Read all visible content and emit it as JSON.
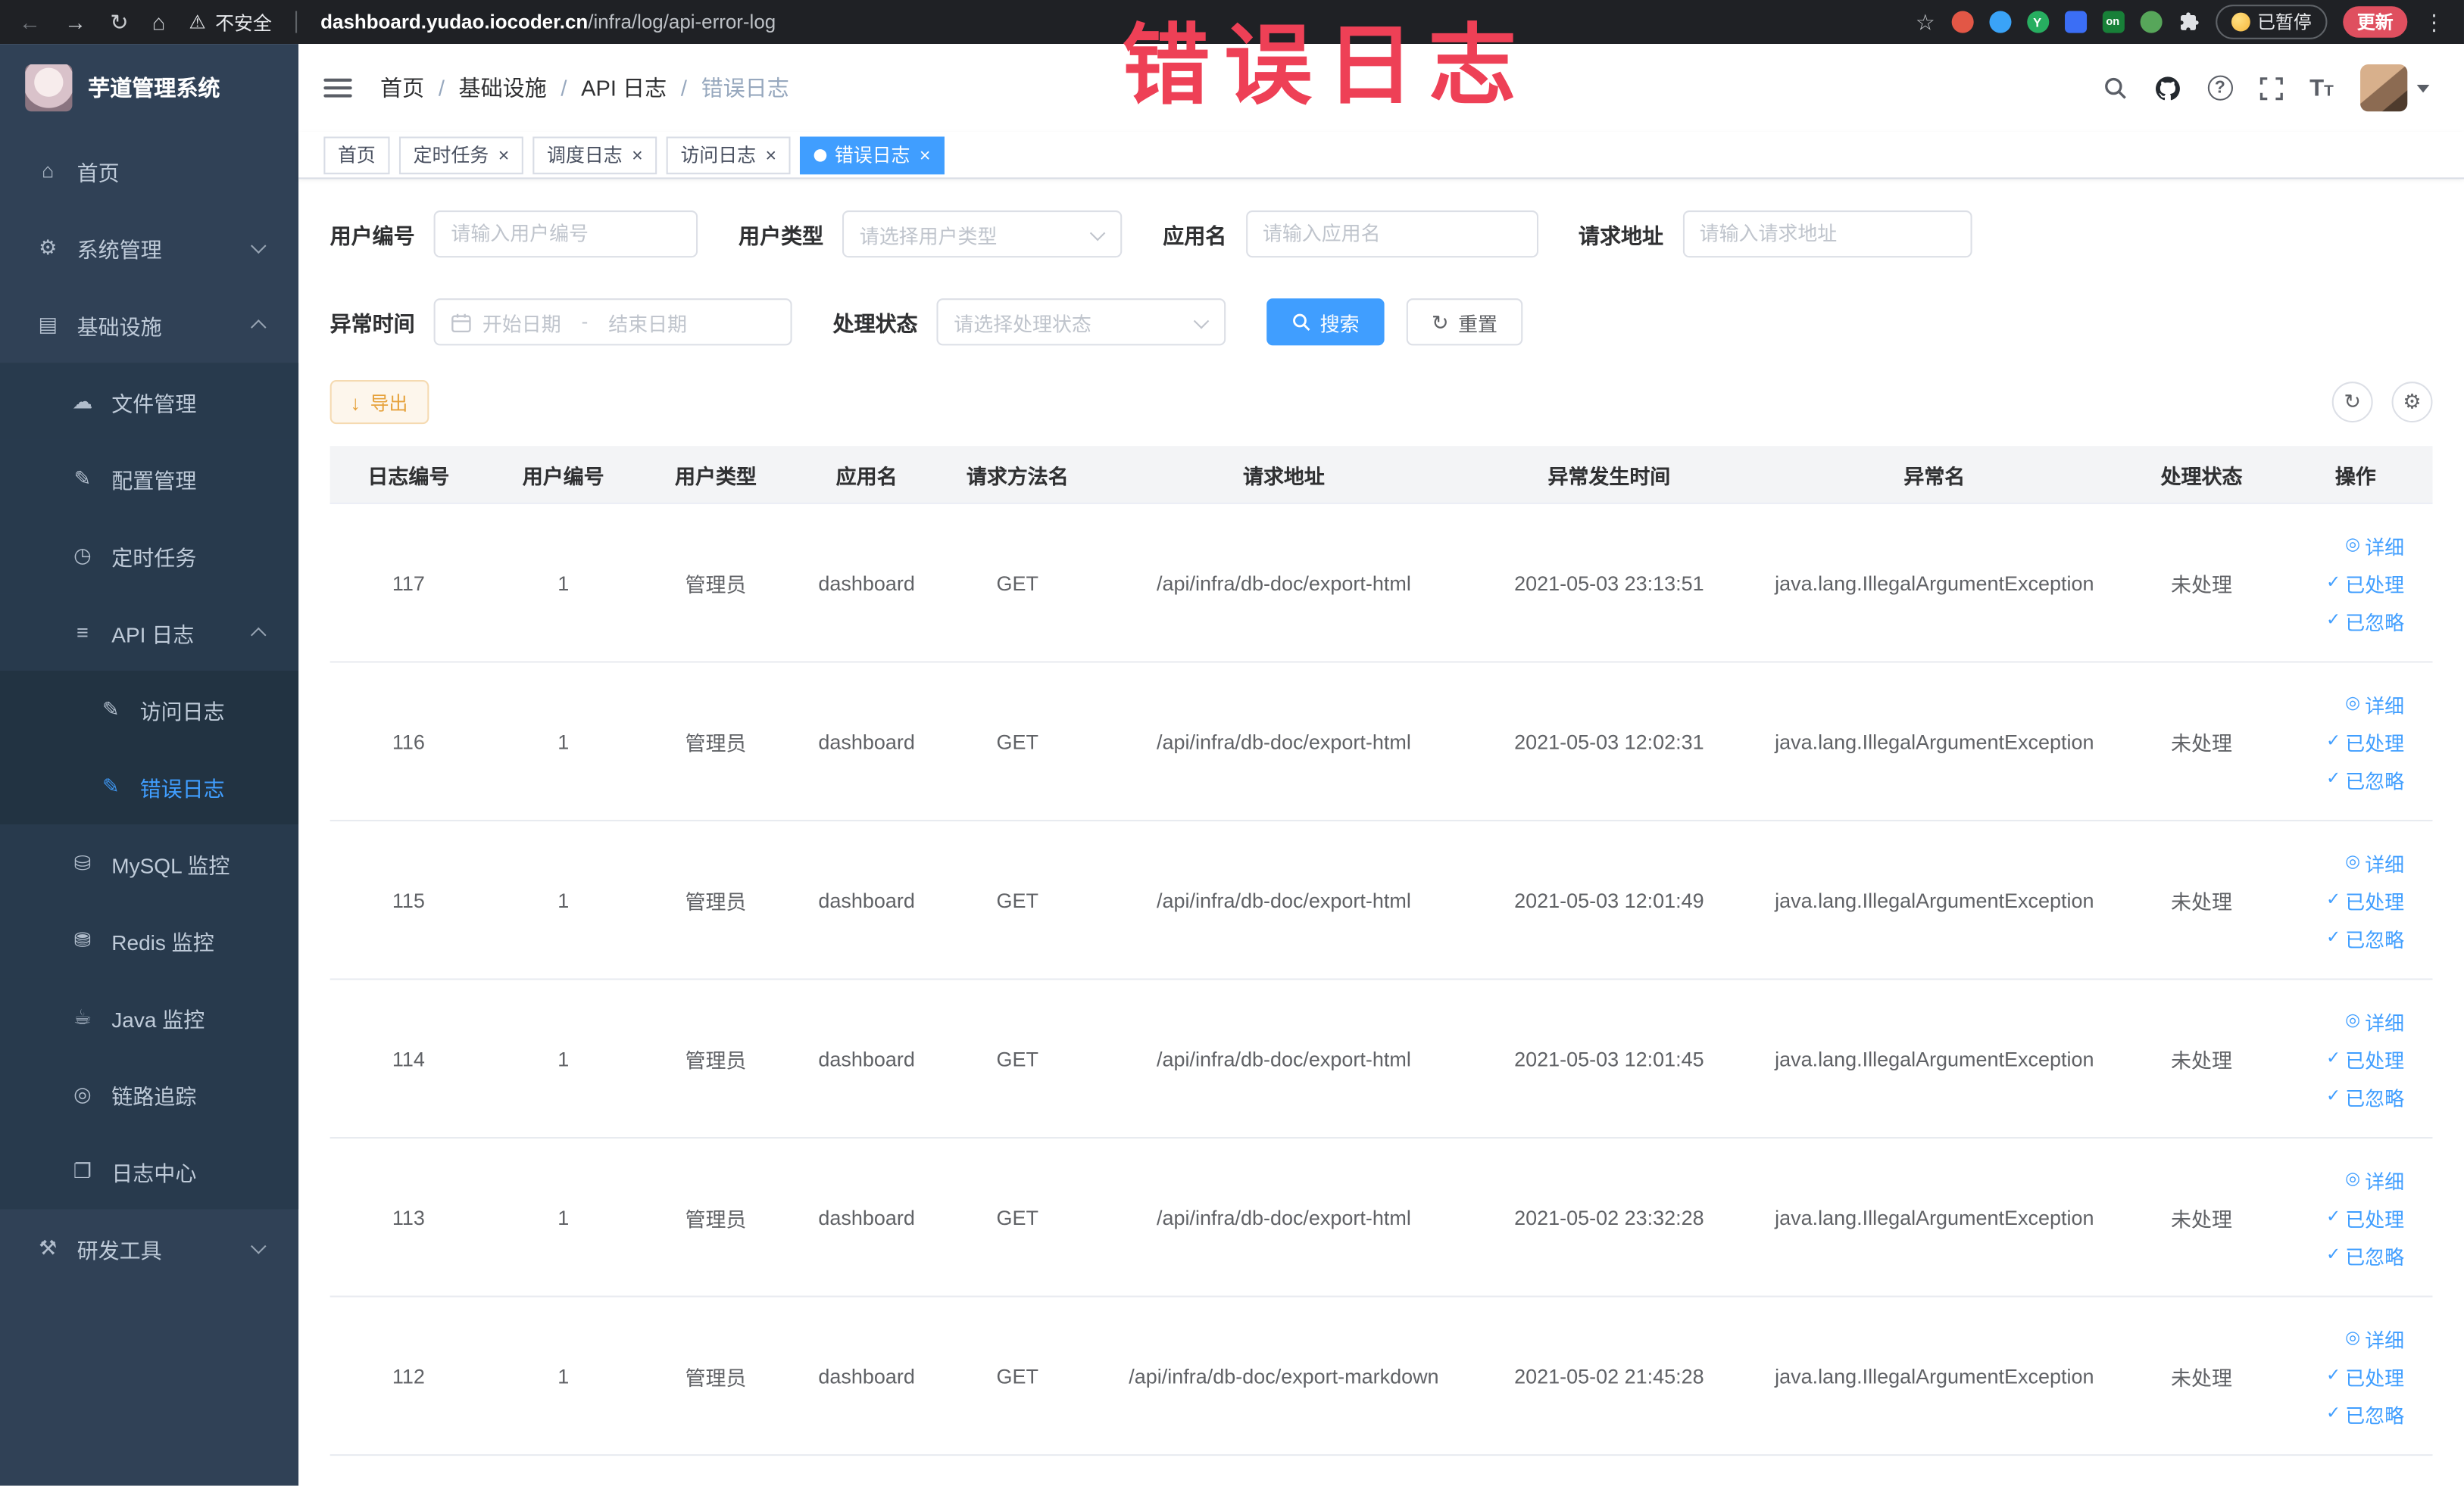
{
  "browser": {
    "security_label": "不安全",
    "url_domain": "dashboard.yudao.iocoder.cn",
    "url_path": "/infra/log/api-error-log",
    "paused_badge_label": "已暂停",
    "update_button_label": "更新",
    "extension_on_label": "on",
    "extension_y_label": "Y"
  },
  "annotation": {
    "watermark_text": "错误日志"
  },
  "sidebar": {
    "logo_title": "芋道管理系统",
    "menu": [
      {
        "name": "home",
        "label": "首页",
        "icon": "home-icon",
        "level": 1
      },
      {
        "name": "system-mgmt",
        "label": "系统管理",
        "icon": "gear-icon",
        "level": 1,
        "arrow": "down"
      },
      {
        "name": "infrastructure",
        "label": "基础设施",
        "icon": "infra-icon",
        "level": 1,
        "arrow": "up"
      },
      {
        "name": "file-mgmt",
        "label": "文件管理",
        "icon": "cloud-icon",
        "level": 2
      },
      {
        "name": "config-mgmt",
        "label": "配置管理",
        "icon": "edit-icon",
        "level": 2
      },
      {
        "name": "scheduled-tasks",
        "label": "定时任务",
        "icon": "clock-icon",
        "level": 2
      },
      {
        "name": "api-log",
        "label": "API 日志",
        "icon": "log-icon",
        "level": 2,
        "arrow": "up"
      },
      {
        "name": "access-log",
        "label": "访问日志",
        "icon": "edit-square-icon",
        "level": 3
      },
      {
        "name": "error-log",
        "label": "错误日志",
        "icon": "edit-square-icon",
        "level": 3,
        "active": true
      },
      {
        "name": "mysql-monitor",
        "label": "MySQL 监控",
        "icon": "database-icon",
        "level": 2
      },
      {
        "name": "redis-monitor",
        "label": "Redis 监控",
        "icon": "stack-icon",
        "level": 2
      },
      {
        "name": "java-monitor",
        "label": "Java 监控",
        "icon": "coffee-icon",
        "level": 2
      },
      {
        "name": "trace",
        "label": "链路追踪",
        "icon": "eye-icon",
        "level": 2
      },
      {
        "name": "log-center",
        "label": "日志中心",
        "icon": "document-icon",
        "level": 2
      },
      {
        "name": "dev-tools",
        "label": "研发工具",
        "icon": "tools-icon",
        "level": 1,
        "arrow": "down"
      }
    ]
  },
  "breadcrumb": [
    "首页",
    "基础设施",
    "API 日志",
    "错误日志"
  ],
  "tabs": [
    {
      "name": "home",
      "label": "首页",
      "closable": false,
      "active": false
    },
    {
      "name": "scheduled-task",
      "label": "定时任务",
      "closable": true,
      "active": false
    },
    {
      "name": "schedule-log",
      "label": "调度日志",
      "closable": true,
      "active": false
    },
    {
      "name": "access-log",
      "label": "访问日志",
      "closable": true,
      "active": false
    },
    {
      "name": "error-log",
      "label": "错误日志",
      "closable": true,
      "active": true
    }
  ],
  "filters": {
    "user_id": {
      "label": "用户编号",
      "placeholder": "请输入用户编号"
    },
    "user_type": {
      "label": "用户类型",
      "placeholder": "请选择用户类型"
    },
    "app_name": {
      "label": "应用名",
      "placeholder": "请输入应用名"
    },
    "request_url": {
      "label": "请求地址",
      "placeholder": "请输入请求地址"
    },
    "exception_time": {
      "label": "异常时间",
      "start_placeholder": "开始日期",
      "separator": "-",
      "end_placeholder": "结束日期"
    },
    "process_status": {
      "label": "处理状态",
      "placeholder": "请选择处理状态"
    },
    "search_button": "搜索",
    "reset_button": "重置"
  },
  "toolbar": {
    "export_button": "导出"
  },
  "table": {
    "columns": [
      "日志编号",
      "用户编号",
      "用户类型",
      "应用名",
      "请求方法名",
      "请求地址",
      "异常发生时间",
      "异常名",
      "处理状态",
      "操作"
    ],
    "rows": [
      {
        "log_id": "117",
        "user_id": "1",
        "user_type": "管理员",
        "app": "dashboard",
        "method": "GET",
        "url": "/api/infra/db-doc/export-html",
        "time": "2021-05-03 23:13:51",
        "exception": "java.lang.IllegalArgumentException",
        "status": "未处理"
      },
      {
        "log_id": "116",
        "user_id": "1",
        "user_type": "管理员",
        "app": "dashboard",
        "method": "GET",
        "url": "/api/infra/db-doc/export-html",
        "time": "2021-05-03 12:02:31",
        "exception": "java.lang.IllegalArgumentException",
        "status": "未处理"
      },
      {
        "log_id": "115",
        "user_id": "1",
        "user_type": "管理员",
        "app": "dashboard",
        "method": "GET",
        "url": "/api/infra/db-doc/export-html",
        "time": "2021-05-03 12:01:49",
        "exception": "java.lang.IllegalArgumentException",
        "status": "未处理"
      },
      {
        "log_id": "114",
        "user_id": "1",
        "user_type": "管理员",
        "app": "dashboard",
        "method": "GET",
        "url": "/api/infra/db-doc/export-html",
        "time": "2021-05-03 12:01:45",
        "exception": "java.lang.IllegalArgumentException",
        "status": "未处理"
      },
      {
        "log_id": "113",
        "user_id": "1",
        "user_type": "管理员",
        "app": "dashboard",
        "method": "GET",
        "url": "/api/infra/db-doc/export-html",
        "time": "2021-05-02 23:32:28",
        "exception": "java.lang.IllegalArgumentException",
        "status": "未处理"
      },
      {
        "log_id": "112",
        "user_id": "1",
        "user_type": "管理员",
        "app": "dashboard",
        "method": "GET",
        "url": "/api/infra/db-doc/export-markdown",
        "time": "2021-05-02 21:45:28",
        "exception": "java.lang.IllegalArgumentException",
        "status": "未处理"
      }
    ],
    "row_actions": [
      {
        "name": "detail",
        "label": "详细",
        "icon": "eye-icon"
      },
      {
        "name": "processed",
        "label": "已处理",
        "icon": "check-icon"
      },
      {
        "name": "ignored",
        "label": "已忽略",
        "icon": "check-icon"
      }
    ]
  },
  "icon_glyphs": {
    "home-icon": "⌂",
    "gear-icon": "⚙",
    "infra-icon": "▤",
    "cloud-icon": "☁",
    "edit-icon": "✎",
    "clock-icon": "◷",
    "log-icon": "≡",
    "edit-square-icon": "✎",
    "database-icon": "⛁",
    "stack-icon": "⛃",
    "coffee-icon": "☕",
    "eye-icon": "◎",
    "document-icon": "❐",
    "tools-icon": "⚒",
    "check-icon": "✓"
  },
  "colors": {
    "accent": "#409eff",
    "sidebar_bg": "#304156",
    "active_tab_bg": "#409eff",
    "warning_text": "#e6a23c",
    "watermark": "#ee4056",
    "link": "#409eff"
  }
}
